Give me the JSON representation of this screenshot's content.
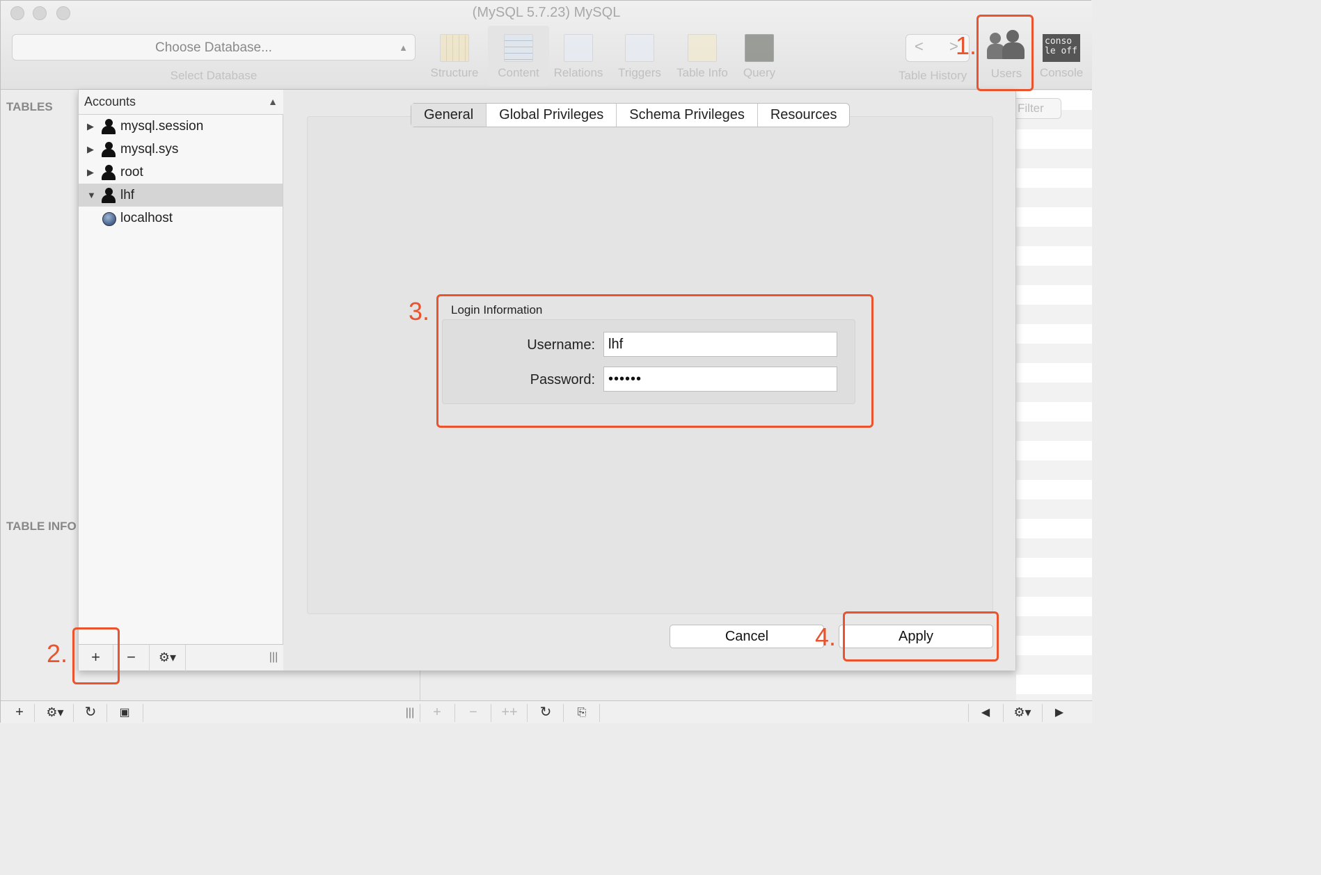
{
  "window": {
    "title": "(MySQL 5.7.23) MySQL"
  },
  "database": {
    "select_placeholder": "Choose Database...",
    "caption": "Select Database"
  },
  "toolbar": {
    "structure": "Structure",
    "content": "Content",
    "relations": "Relations",
    "triggers": "Triggers",
    "table_info": "Table Info",
    "query": "Query",
    "table_history": "Table History",
    "users": "Users",
    "console": "Console",
    "console_icon_text": "conso le off"
  },
  "sidebar": {
    "tables_label": "TABLES",
    "table_info_label": "TABLE INFO",
    "filter_placeholder": "Filter"
  },
  "accounts": {
    "header": "Accounts",
    "items": [
      {
        "label": "mysql.session",
        "expanded": false
      },
      {
        "label": "mysql.sys",
        "expanded": false
      },
      {
        "label": "root",
        "expanded": false
      },
      {
        "label": "lhf",
        "expanded": true,
        "selected": true,
        "hosts": [
          "localhost"
        ]
      }
    ]
  },
  "tabs": [
    "General",
    "Global Privileges",
    "Schema Privileges",
    "Resources"
  ],
  "active_tab": "General",
  "login": {
    "title": "Login Information",
    "username_label": "Username:",
    "username_value": "lhf",
    "password_label": "Password:",
    "password_value": "••••••"
  },
  "buttons": {
    "cancel": "Cancel",
    "apply": "Apply"
  },
  "annotations": {
    "step1": "1.",
    "step2": "2.",
    "step3": "3.",
    "step4": "4."
  },
  "colors": {
    "annotation": "#e9542f"
  }
}
